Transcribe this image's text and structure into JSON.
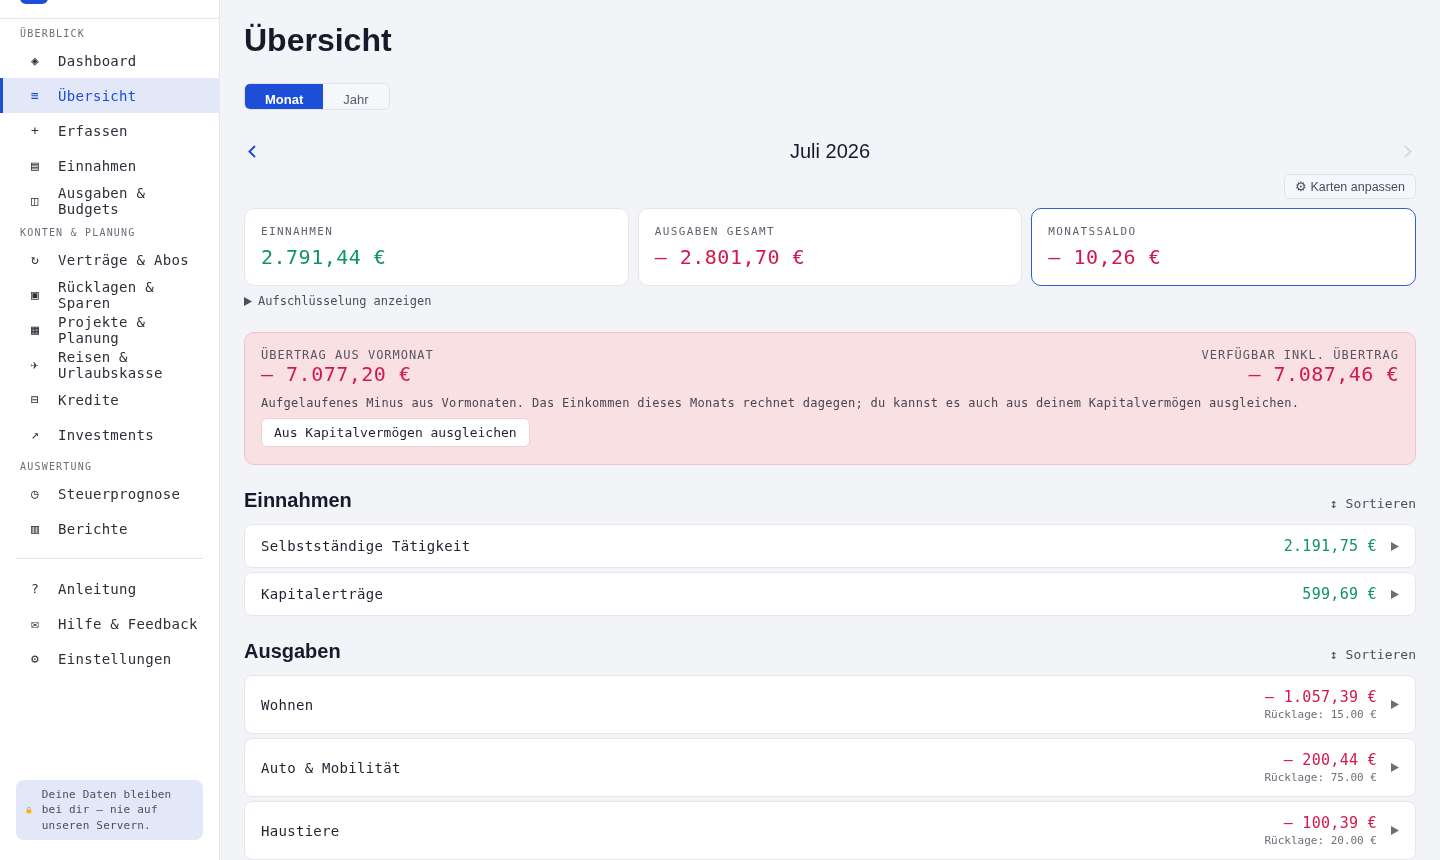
{
  "sidebar": {
    "sections": [
      {
        "title": "ÜBERBLICK",
        "items": [
          {
            "icon": "◈",
            "label": "Dashboard",
            "selected": false
          },
          {
            "icon": "≡",
            "label": "Übersicht",
            "selected": true
          },
          {
            "icon": "+",
            "label": "Erfassen",
            "selected": false
          },
          {
            "icon": "▤",
            "label": "Einnahmen",
            "selected": false
          },
          {
            "icon": "◫",
            "label": "Ausgaben & Budgets",
            "selected": false
          }
        ]
      },
      {
        "title": "KONTEN & PLANUNG",
        "items": [
          {
            "icon": "↻",
            "label": "Verträge & Abos",
            "selected": false
          },
          {
            "icon": "▣",
            "label": "Rücklagen & Sparen",
            "selected": false
          },
          {
            "icon": "▦",
            "label": "Projekte & Planung",
            "selected": false
          },
          {
            "icon": "✈",
            "label": "Reisen & Urlaubskasse",
            "selected": false
          },
          {
            "icon": "⊟",
            "label": "Kredite",
            "selected": false
          },
          {
            "icon": "↗",
            "label": "Investments",
            "selected": false
          }
        ]
      },
      {
        "title": "AUSWERTUNG",
        "items": [
          {
            "icon": "◷",
            "label": "Steuerprognose",
            "selected": false
          },
          {
            "icon": "▥",
            "label": "Berichte",
            "selected": false
          }
        ]
      }
    ],
    "bottom_items": [
      {
        "icon": "?",
        "label": "Anleitung",
        "selected": false
      },
      {
        "icon": "✉",
        "label": "Hilfe & Feedback",
        "selected": false
      },
      {
        "icon": "⚙",
        "label": "Einstellungen",
        "selected": false
      }
    ],
    "privacy_note": "Deine Daten bleiben bei dir – nie auf unseren Servern."
  },
  "title": "Übersicht",
  "tabs": [
    {
      "label": "Monat",
      "selected": true
    },
    {
      "label": "Jahr",
      "selected": false
    }
  ],
  "period": {
    "label": "Juli 2026",
    "prev_disabled": false,
    "next_disabled": true
  },
  "customize_button": "⚙ Karten anpassen",
  "cards": [
    {
      "label": "EINNAHMEN",
      "value": "2.791,44 €",
      "color": "#0f9466",
      "highlighted": false
    },
    {
      "label": "AUSGABEN GESAMT",
      "value": "– 2.801,70 €",
      "color": "#d3194a",
      "highlighted": false
    },
    {
      "label": "MONATSSALDO",
      "value": "– 10,26 €",
      "color": "#d3194a",
      "highlighted": true
    }
  ],
  "breakdown_toggle": {
    "label": "Aufschlüsselung anzeigen",
    "expanded": false
  },
  "carryover": {
    "label": "ÜBERTRAG AUS VORMONAT",
    "value": "– 7.077,20 €",
    "available_label": "VERFÜGBAR INKL. ÜBERTRAG",
    "available_value": "– 7.087,46 €",
    "text": "Aufgelaufenes Minus aus Vormonaten. Das Einkommen dieses Monats rechnet dagegen; du kannst es auch aus deinem Kapitalvermögen ausgleichen.",
    "button": "Aus Kapitalvermögen ausgleichen"
  },
  "income": {
    "title": "Einnahmen",
    "sort": "↕ Sortieren",
    "rows": [
      {
        "name": "Selbstständige Tätigkeit",
        "amount": "2.191,75 €",
        "color": "#0f9466"
      },
      {
        "name": "Kapitalerträge",
        "amount": "599,69 €",
        "color": "#0f9466"
      }
    ]
  },
  "expenses": {
    "title": "Ausgaben",
    "sort": "↕ Sortieren",
    "rows": [
      {
        "name": "Wohnen",
        "amount": "– 1.057,39 €",
        "color": "#d3194a",
        "reserve": "Rücklage: 15.00 €"
      },
      {
        "name": "Auto & Mobilität",
        "amount": "– 200,44 €",
        "color": "#d3194a",
        "reserve": "Rücklage: 75.00 €"
      },
      {
        "name": "Haustiere",
        "amount": "– 100,39 €",
        "color": "#d3194a",
        "reserve": "Rücklage: 20.00 €"
      }
    ]
  }
}
